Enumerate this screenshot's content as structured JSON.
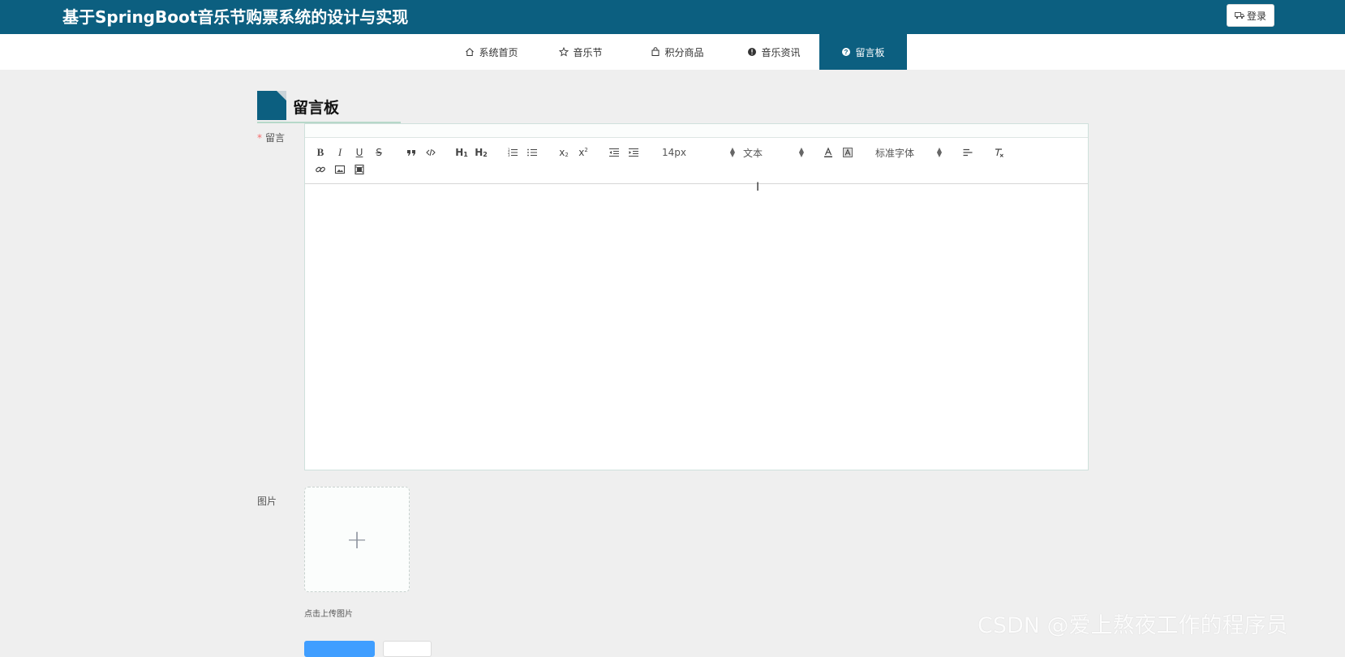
{
  "header": {
    "title": "基于SpringBoot音乐节购票系统的设计与实现",
    "login_label": "登录"
  },
  "nav": {
    "items": [
      {
        "label": "系统首页",
        "icon": "home-icon"
      },
      {
        "label": "音乐节",
        "icon": "star-icon"
      },
      {
        "label": "积分商品",
        "icon": "bag-icon"
      },
      {
        "label": "音乐资讯",
        "icon": "info-icon"
      },
      {
        "label": "留言板",
        "icon": "question-icon",
        "active": true
      }
    ]
  },
  "section": {
    "title": "留言板"
  },
  "form": {
    "message_label": "留言",
    "required_mark": "*",
    "image_label": "图片",
    "upload_hint": "点击上传图片"
  },
  "editor": {
    "font_size": "14px",
    "header_select": "文本",
    "font_family": "标准字体",
    "toolbar_buttons": [
      "bold",
      "italic",
      "underline",
      "strike",
      "blockquote",
      "code-block",
      "h1",
      "h2",
      "ordered-list",
      "bullet-list",
      "subscript",
      "superscript",
      "outdent",
      "indent",
      "text-color",
      "background-color",
      "align",
      "clean",
      "link",
      "image",
      "video"
    ]
  },
  "watermark": "CSDN @爱上熬夜工作的程序员",
  "colors": {
    "primary": "#0c5f80",
    "required": "#f56c6c",
    "submit": "#409eff"
  }
}
